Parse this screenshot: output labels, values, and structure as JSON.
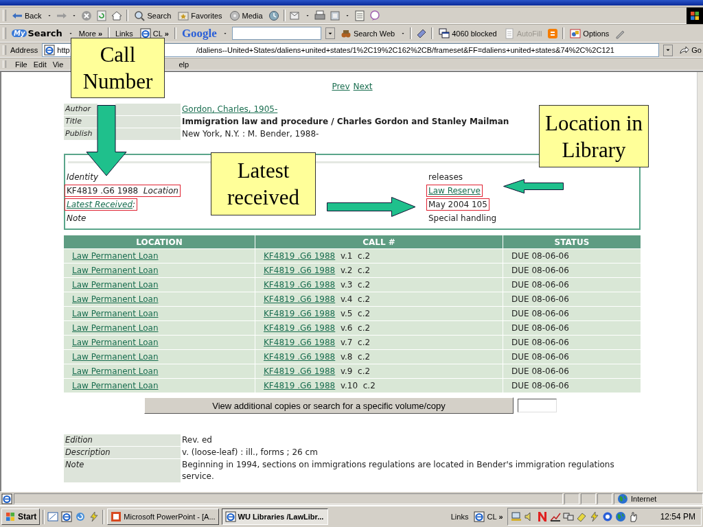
{
  "standard_toolbar": {
    "back_label": "Back",
    "search_label": "Search",
    "favorites_label": "Favorites",
    "media_label": "Media"
  },
  "search_toolbar": {
    "logo_mark": "My",
    "logo_text": "Search",
    "more_label": "More",
    "more_chevron": "»",
    "links_label": "Links",
    "link_item": "CL",
    "links_chevron": "»",
    "google_logo": "Google",
    "search_web_label": "Search Web",
    "blocked_label": "4060 blocked",
    "autofill": {
      "label": "AutoFill",
      "disabled": true
    },
    "options_label": "Options"
  },
  "address_bar": {
    "label": "Address",
    "url_start": "http",
    "url_rest": "/daliens--United+States/daliens+united+states/1%2C19%2C162%2CB/frameset&FF=daliens+united+states&74%2C%2C121",
    "go_label": "Go"
  },
  "menu_bar": [
    "File",
    "Edit",
    "Vie",
    "elp"
  ],
  "page": {
    "nav_links": [
      "Prev",
      "Next"
    ],
    "record": [
      {
        "label": "Author",
        "value": "Gordon, Charles, 1905-",
        "kind": "link"
      },
      {
        "label": "Title",
        "value": "Immigration law and procedure / Charles Gordon and Stanley Mailman",
        "kind": "bold"
      },
      {
        "label": "Publish",
        "value": "New York, N.Y. : M. Bender, 1988-",
        "kind": "plain"
      }
    ],
    "holdings_box": {
      "left": [
        {
          "text": "Identity",
          "kind": "italic",
          "highlighted": false
        },
        {
          "text": "KF4819 .G6 1988  *Location*",
          "kind": "plain",
          "highlighted": true
        },
        {
          "text": "Latest Received",
          "suffix": ":",
          "kind": "link",
          "highlighted": true
        },
        {
          "text": "Note",
          "kind": "italic",
          "highlighted": false
        }
      ],
      "right": [
        {
          "text": "releases",
          "kind": "plain",
          "highlighted": false
        },
        {
          "text": "Law Reserve",
          "kind": "link",
          "highlighted": true
        },
        {
          "text": "May 2004 105",
          "kind": "plain",
          "highlighted": true
        },
        {
          "text": "Special handling",
          "kind": "plain",
          "highlighted": false
        }
      ]
    },
    "holdings_table": {
      "columns": [
        "LOCATION",
        "CALL #",
        "STATUS"
      ],
      "rows": [
        {
          "location": "Law Permanent Loan",
          "call_number": "KF4819 .G6 1988",
          "copy": "v.1  c.2",
          "status": "DUE 08-06-06"
        },
        {
          "location": "Law Permanent Loan",
          "call_number": "KF4819 .G6 1988",
          "copy": "v.2  c.2",
          "status": "DUE 08-06-06"
        },
        {
          "location": "Law Permanent Loan",
          "call_number": "KF4819 .G6 1988",
          "copy": "v.3  c.2",
          "status": "DUE 08-06-06"
        },
        {
          "location": "Law Permanent Loan",
          "call_number": "KF4819 .G6 1988",
          "copy": "v.4  c.2",
          "status": "DUE 08-06-06"
        },
        {
          "location": "Law Permanent Loan",
          "call_number": "KF4819 .G6 1988",
          "copy": "v.5  c.2",
          "status": "DUE 08-06-06"
        },
        {
          "location": "Law Permanent Loan",
          "call_number": "KF4819 .G6 1988",
          "copy": "v.6  c.2",
          "status": "DUE 08-06-06"
        },
        {
          "location": "Law Permanent Loan",
          "call_number": "KF4819 .G6 1988",
          "copy": "v.7  c.2",
          "status": "DUE 08-06-06"
        },
        {
          "location": "Law Permanent Loan",
          "call_number": "KF4819 .G6 1988",
          "copy": "v.8  c.2",
          "status": "DUE 08-06-06"
        },
        {
          "location": "Law Permanent Loan",
          "call_number": "KF4819 .G6 1988",
          "copy": "v.9  c.2",
          "status": "DUE 08-06-06"
        },
        {
          "location": "Law Permanent Loan",
          "call_number": "KF4819 .G6 1988",
          "copy": "v.10  c.2",
          "status": "DUE 08-06-06"
        }
      ]
    },
    "copy_search": {
      "button": "View additional copies or search for a specific volume/copy"
    },
    "details": [
      {
        "label": "Edition",
        "value": "Rev. ed"
      },
      {
        "label": "Description",
        "value": "v. (loose-leaf) : ill., forms ; 26 cm"
      },
      {
        "label": "Note",
        "value": "Beginning in 1994, sections on immigrations regulations are located in Bender's immigration regulations service."
      }
    ]
  },
  "callouts": [
    "Call Number",
    "Latest received",
    "Location in Library"
  ],
  "status_bar": {
    "zone": "Internet"
  },
  "taskbar": {
    "start": "Start",
    "tasks": [
      {
        "label": "Microsoft PowerPoint - [A...",
        "selected": false
      },
      {
        "label": "WU Libraries /LawLibr...",
        "selected": true
      }
    ],
    "links_label": "Links",
    "link_item": "CL",
    "chevron": "»",
    "clock": "12:54 PM"
  }
}
